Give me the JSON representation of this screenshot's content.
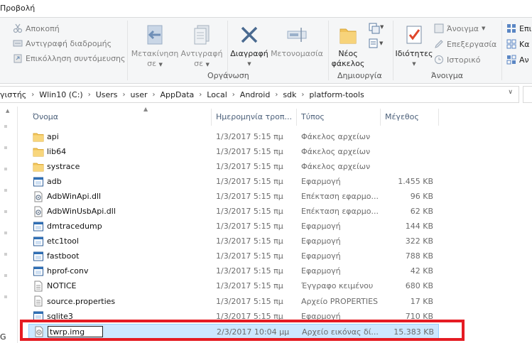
{
  "ribbon": {
    "tab_view": "Προβολή",
    "clipboard": {
      "cut": "Αποκοπή",
      "copy_path": "Αντιγραφή διαδρομής",
      "paste_shortcut": "Επικόλληση συντόμευσης"
    },
    "organize": {
      "move_to": "Μετακίνηση",
      "move_to_2": "σε",
      "copy_to": "Αντιγραφή",
      "copy_to_2": "σε",
      "delete": "Διαγραφή",
      "rename": "Μετονομασία",
      "group_label": "Οργάνωση"
    },
    "create": {
      "new_folder": "Νέος",
      "new_folder_2": "φάκελος",
      "group_label": "Δημιουργία"
    },
    "open": {
      "properties": "Ιδιότητες",
      "open": "Άνοιγμα",
      "edit": "Επεξεργασία",
      "history": "Ιστορικό",
      "group_label": "Άνοιγμα"
    },
    "select": {
      "item1": "Επι",
      "item2": "Κα",
      "item3": "Αν"
    }
  },
  "address": {
    "crumbs": [
      "γιστής",
      "Wlin10 (C:)",
      "Users",
      "user",
      "AppData",
      "Local",
      "Android",
      "sdk",
      "platform-tools"
    ]
  },
  "columns": {
    "name": "Όνομα",
    "date": "Ημερομηνία τροπ...",
    "type": "Τύπος",
    "size": "Μέγεθος"
  },
  "files": [
    {
      "icon": "folder",
      "name": "api",
      "date": "1/3/2017 5:15 πμ",
      "type": "Φάκελος αρχείων",
      "size": ""
    },
    {
      "icon": "folder",
      "name": "lib64",
      "date": "1/3/2017 5:15 πμ",
      "type": "Φάκελος αρχείων",
      "size": ""
    },
    {
      "icon": "folder",
      "name": "systrace",
      "date": "1/3/2017 5:15 πμ",
      "type": "Φάκελος αρχείων",
      "size": ""
    },
    {
      "icon": "exe",
      "name": "adb",
      "date": "1/3/2017 5:15 πμ",
      "type": "Εφαρμογή",
      "size": "1.455 KB"
    },
    {
      "icon": "dll",
      "name": "AdbWinApi.dll",
      "date": "1/3/2017 5:15 πμ",
      "type": "Επέκταση εφαρμο...",
      "size": "96 KB"
    },
    {
      "icon": "dll",
      "name": "AdbWinUsbApi.dll",
      "date": "1/3/2017 5:15 πμ",
      "type": "Επέκταση εφαρμο...",
      "size": "62 KB"
    },
    {
      "icon": "exe",
      "name": "dmtracedump",
      "date": "1/3/2017 5:15 πμ",
      "type": "Εφαρμογή",
      "size": "144 KB"
    },
    {
      "icon": "exe",
      "name": "etc1tool",
      "date": "1/3/2017 5:15 πμ",
      "type": "Εφαρμογή",
      "size": "322 KB"
    },
    {
      "icon": "exe",
      "name": "fastboot",
      "date": "1/3/2017 5:15 πμ",
      "type": "Εφαρμογή",
      "size": "788 KB"
    },
    {
      "icon": "exe",
      "name": "hprof-conv",
      "date": "1/3/2017 5:15 πμ",
      "type": "Εφαρμογή",
      "size": "42 KB"
    },
    {
      "icon": "doc",
      "name": "NOTICE",
      "date": "1/3/2017 5:15 πμ",
      "type": "Έγγραφο κειμένου",
      "size": "680 KB"
    },
    {
      "icon": "doc",
      "name": "source.properties",
      "date": "1/3/2017 5:15 πμ",
      "type": "Αρχείο PROPERTIES",
      "size": "17 KB"
    },
    {
      "icon": "exe",
      "name": "sqlite3",
      "date": "1/3/2017 5:15 πμ",
      "type": "Εφαρμογή",
      "size": "710 KB"
    },
    {
      "icon": "img",
      "name": "twrp.img",
      "date": "2/3/2017 10:04 μμ",
      "type": "Αρχείο εικόνας δί...",
      "size": "15.383 KB",
      "selected": true,
      "renaming": true
    }
  ],
  "left_letter": "G"
}
